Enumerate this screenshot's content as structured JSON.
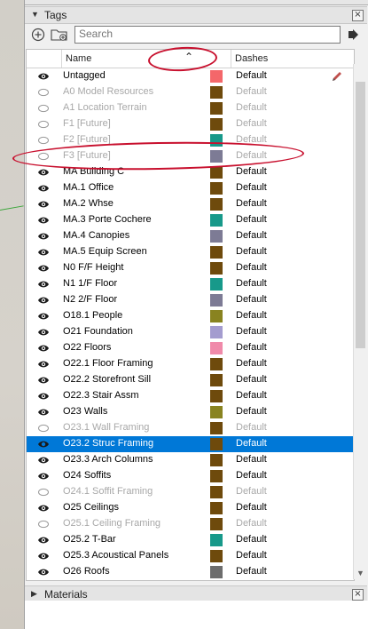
{
  "tags_panel": {
    "title": "Tags",
    "search_placeholder": "Search",
    "columns": {
      "name": "Name",
      "dashes": "Dashes"
    },
    "rows": [
      {
        "name": "Untagged",
        "color": "#f4676a",
        "dashes": "Default",
        "visible": true,
        "enabled": true
      },
      {
        "name": "A0 Model Resources",
        "color": "#6e4a0c",
        "dashes": "Default",
        "visible": false,
        "enabled": false
      },
      {
        "name": "A1 Location Terrain",
        "color": "#6e4a0c",
        "dashes": "Default",
        "visible": false,
        "enabled": false
      },
      {
        "name": "F1 [Future]",
        "color": "#6e4a0c",
        "dashes": "Default",
        "visible": false,
        "enabled": false
      },
      {
        "name": "F2 [Future]",
        "color": "#17998a",
        "dashes": "Default",
        "visible": false,
        "enabled": false
      },
      {
        "name": "F3 [Future]",
        "color": "#7d7b95",
        "dashes": "Default",
        "visible": false,
        "enabled": false
      },
      {
        "name": "MA Building C",
        "color": "#6e4a0c",
        "dashes": "Default",
        "visible": true,
        "enabled": true
      },
      {
        "name": "MA.1 Office",
        "color": "#6e4a0c",
        "dashes": "Default",
        "visible": true,
        "enabled": true
      },
      {
        "name": "MA.2 Whse",
        "color": "#6e4a0c",
        "dashes": "Default",
        "visible": true,
        "enabled": true
      },
      {
        "name": "MA.3 Porte Cochere",
        "color": "#17998a",
        "dashes": "Default",
        "visible": true,
        "enabled": true
      },
      {
        "name": "MA.4 Canopies",
        "color": "#7d7b95",
        "dashes": "Default",
        "visible": true,
        "enabled": true
      },
      {
        "name": "MA.5 Equip Screen",
        "color": "#6e4a0c",
        "dashes": "Default",
        "visible": true,
        "enabled": true
      },
      {
        "name": "N0 F/F Height",
        "color": "#6e4a0c",
        "dashes": "Default",
        "visible": true,
        "enabled": true
      },
      {
        "name": "N1 1/F Floor",
        "color": "#17998a",
        "dashes": "Default",
        "visible": true,
        "enabled": true
      },
      {
        "name": "N2 2/F Floor",
        "color": "#7d7b95",
        "dashes": "Default",
        "visible": true,
        "enabled": true
      },
      {
        "name": "O18.1 People",
        "color": "#898320",
        "dashes": "Default",
        "visible": true,
        "enabled": true
      },
      {
        "name": "O21 Foundation",
        "color": "#a49ccf",
        "dashes": "Default",
        "visible": true,
        "enabled": true
      },
      {
        "name": "O22 Floors",
        "color": "#f08aaa",
        "dashes": "Default",
        "visible": true,
        "enabled": true
      },
      {
        "name": "O22.1 Floor Framing",
        "color": "#6e4a0c",
        "dashes": "Default",
        "visible": true,
        "enabled": true
      },
      {
        "name": "O22.2 Storefront Sill",
        "color": "#6e4a0c",
        "dashes": "Default",
        "visible": true,
        "enabled": true
      },
      {
        "name": "O22.3 Stair Assm",
        "color": "#6e4a0c",
        "dashes": "Default",
        "visible": true,
        "enabled": true
      },
      {
        "name": "O23 Walls",
        "color": "#898320",
        "dashes": "Default",
        "visible": true,
        "enabled": true
      },
      {
        "name": "O23.1 Wall Framing",
        "color": "#6e4a0c",
        "dashes": "Default",
        "visible": false,
        "enabled": false
      },
      {
        "name": "O23.2 Struc Framing",
        "color": "#6e4a0c",
        "dashes": "Default",
        "visible": true,
        "enabled": true,
        "selected": true
      },
      {
        "name": "O23.3 Arch Columns",
        "color": "#6e4a0c",
        "dashes": "Default",
        "visible": true,
        "enabled": true
      },
      {
        "name": "O24 Soffits",
        "color": "#6e4a0c",
        "dashes": "Default",
        "visible": true,
        "enabled": true
      },
      {
        "name": "O24.1 Soffit Framing",
        "color": "#6e4a0c",
        "dashes": "Default",
        "visible": false,
        "enabled": false
      },
      {
        "name": "O25 Ceilings",
        "color": "#6e4a0c",
        "dashes": "Default",
        "visible": true,
        "enabled": true
      },
      {
        "name": "O25.1 Ceiling Framing",
        "color": "#6e4a0c",
        "dashes": "Default",
        "visible": false,
        "enabled": false
      },
      {
        "name": "O25.2 T-Bar",
        "color": "#17998a",
        "dashes": "Default",
        "visible": true,
        "enabled": true
      },
      {
        "name": "O25.3 Acoustical Panels",
        "color": "#6e4a0c",
        "dashes": "Default",
        "visible": true,
        "enabled": true
      },
      {
        "name": "O26 Roofs",
        "color": "#6d6d6d",
        "dashes": "Default",
        "visible": true,
        "enabled": true
      }
    ]
  },
  "materials_panel": {
    "title": "Materials"
  },
  "colors": {
    "selection": "#0078d7",
    "annotation": "#c8102e"
  }
}
